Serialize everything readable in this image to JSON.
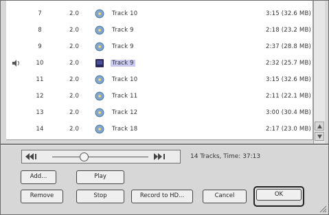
{
  "tracks": [
    {
      "num": "7",
      "version": "2.0",
      "title": "Track 10",
      "duration": "3:15 (32.6 MB)",
      "playing": false,
      "selected": false
    },
    {
      "num": "8",
      "version": "2.0",
      "title": "Track 9",
      "duration": "2:18 (23.2 MB)",
      "playing": false,
      "selected": false
    },
    {
      "num": "9",
      "version": "2.0",
      "title": "Track 9",
      "duration": "2:37 (28.8 MB)",
      "playing": false,
      "selected": false
    },
    {
      "num": "10",
      "version": "2.0",
      "title": "Track 9",
      "duration": "2:32 (25.7 MB)",
      "playing": true,
      "selected": true
    },
    {
      "num": "11",
      "version": "2.0",
      "title": "Track 10",
      "duration": "3:15 (32.6 MB)",
      "playing": false,
      "selected": false
    },
    {
      "num": "12",
      "version": "2.0",
      "title": "Track 11",
      "duration": "2:11 (22.1 MB)",
      "playing": false,
      "selected": false
    },
    {
      "num": "13",
      "version": "2.0",
      "title": "Track 12",
      "duration": "3:00 (30.4 MB)",
      "playing": false,
      "selected": false
    },
    {
      "num": "14",
      "version": "2.0",
      "title": "Track 18",
      "duration": "2:17 (23.0 MB)",
      "playing": false,
      "selected": false
    }
  ],
  "status": {
    "text": "14 Tracks, Time: 37:13"
  },
  "buttons": {
    "add": "Add...",
    "play": "Play",
    "remove": "Remove",
    "stop": "Stop",
    "record": "Record to HD...",
    "cancel": "Cancel",
    "ok": "OK"
  },
  "icons": {
    "track": "cd-track-icon",
    "selected_track": "cd-track-selected-icon",
    "playing": "speaker-icon"
  },
  "colors": {
    "selection": "#c9c9f2",
    "list_background": "#ffffff",
    "window_background": "#d7d7d7"
  }
}
